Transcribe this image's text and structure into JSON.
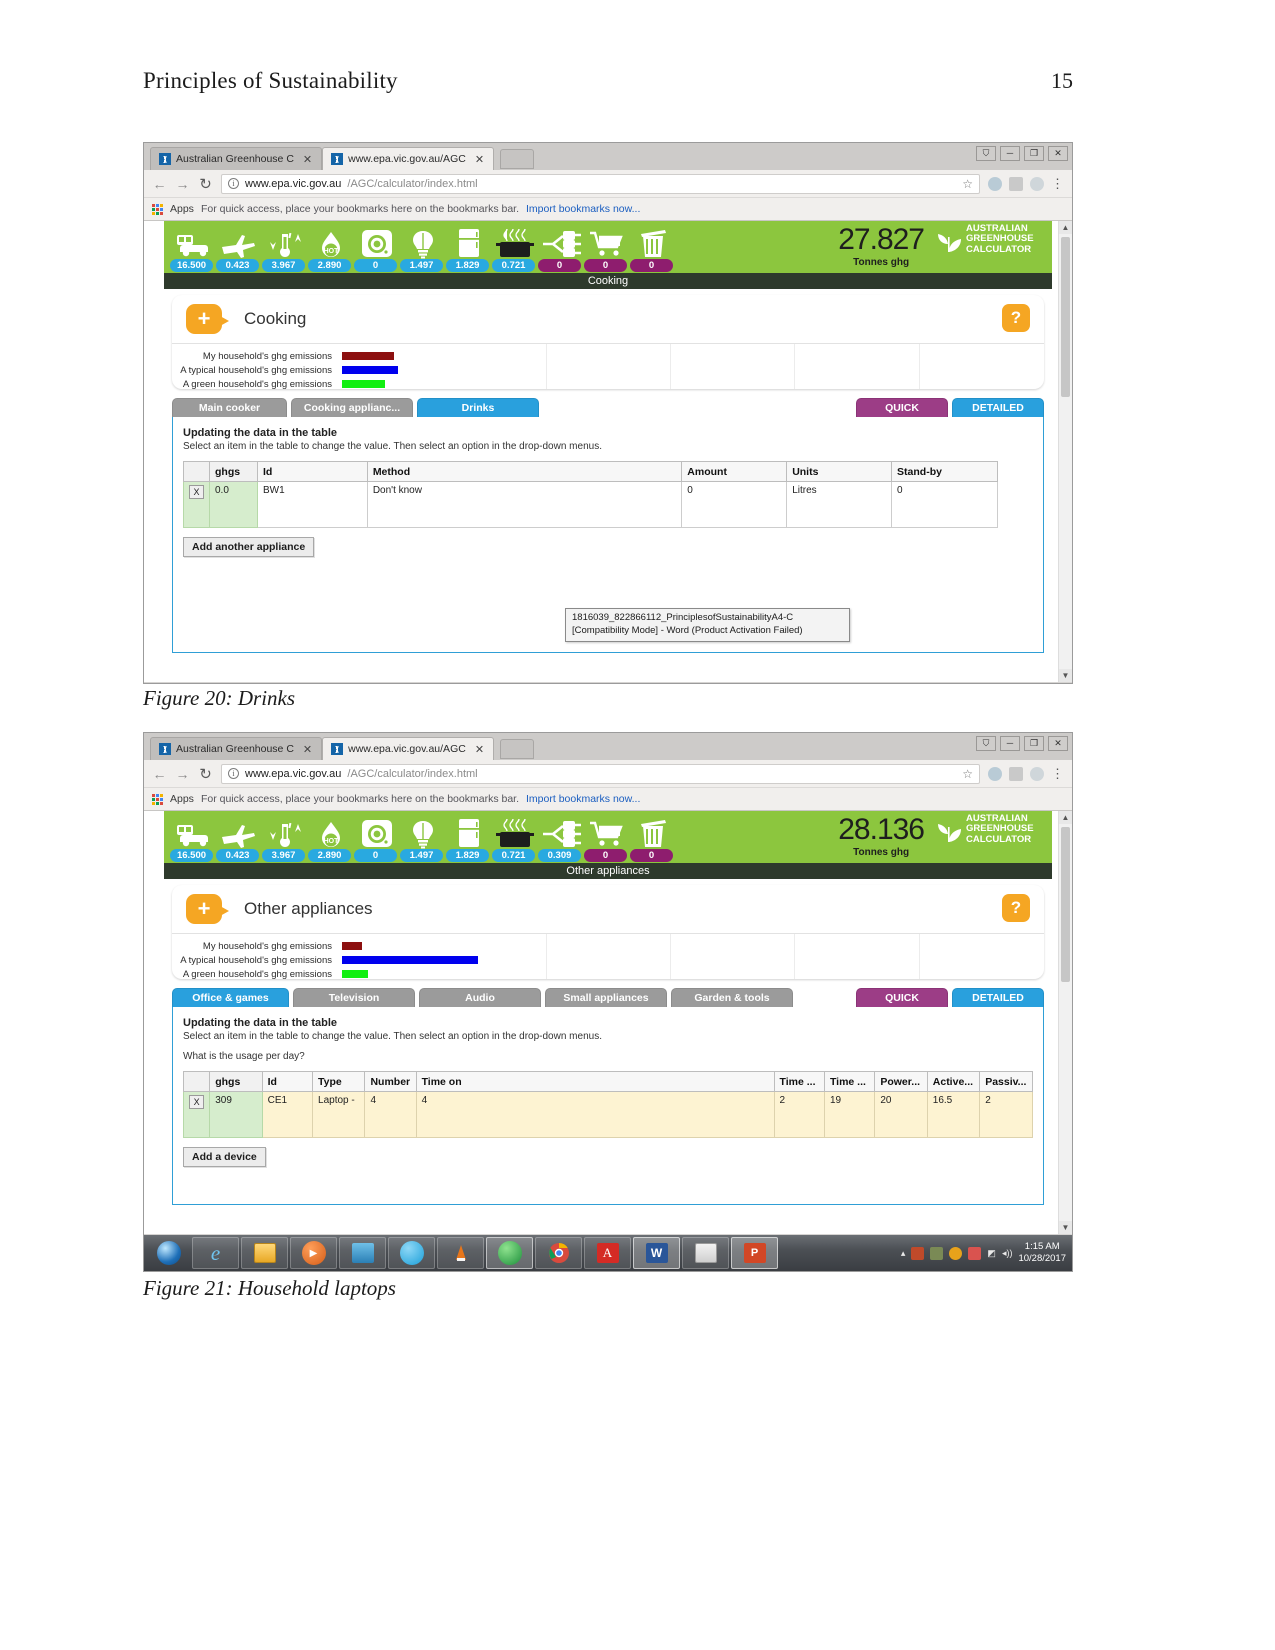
{
  "page": {
    "title": "Principles of Sustainability",
    "number": "15"
  },
  "captions": {
    "figure20": "Figure 20: Drinks",
    "figure21": "Figure 21: Household laptops"
  },
  "browser": {
    "tabs": [
      {
        "label": "Australian Greenhouse C",
        "close": "✕",
        "active": false
      },
      {
        "label": "www.epa.vic.gov.au/AGC",
        "close": "✕",
        "active": true
      }
    ],
    "window_controls": {
      "account": "⛉",
      "minimize": "─",
      "maximize": "❐",
      "close": "✕"
    },
    "nav": {
      "back": "←",
      "forward": "→",
      "reload": "↻",
      "info": "i",
      "star": "☆",
      "menu": "⋮"
    },
    "url": {
      "host": "www.epa.vic.gov.au",
      "rest": "/AGC/calculator/index.html"
    },
    "bookmarks": {
      "apps_label": "Apps",
      "hint": "For quick access, place your bookmarks here on the bookmarks bar.",
      "link": "Import bookmarks now..."
    }
  },
  "calculator": {
    "icons": [
      "car-icon",
      "plane-icon",
      "thermometer-icon",
      "hot-water-icon",
      "washing-machine-icon",
      "lightbulb-icon",
      "fridge-icon",
      "cooking-pot-icon",
      "appliances-plug-icon",
      "shopping-trolley-icon",
      "waste-bin-icon"
    ],
    "brand": {
      "line1": "AUSTRALIAN",
      "line2": "GREENHOUSE",
      "line3": "CALCULATOR"
    },
    "unit_label": "Tonnes ghg",
    "legend": [
      {
        "label": "My household's ghg emissions",
        "color": "#8c0f0f"
      },
      {
        "label": "A typical household's ghg emissions",
        "color": "#0000ee"
      },
      {
        "label": "A green household's ghg emissions",
        "color": "#11ef11"
      }
    ],
    "updating_heading": "Updating the data in the table",
    "updating_text": "Select an item in the table to change the value. Then select an option in the drop-down menus.",
    "quick_label": "QUICK",
    "detailed_label": "DETAILED"
  },
  "figure20": {
    "values": [
      "16.500",
      "0.423",
      "3.967",
      "2.890",
      "0",
      "1.497",
      "1.829",
      "0.721",
      "0",
      "0",
      "0"
    ],
    "value_colors": [
      "blue",
      "blue",
      "blue",
      "blue",
      "blue",
      "blue",
      "blue",
      "blue",
      "purple",
      "purple",
      "purple"
    ],
    "total": "27.827",
    "section_strip": "Cooking",
    "panel_title": "Cooking",
    "plus_label": "+",
    "help_label": "?",
    "legend_bar_widths": [
      "52",
      "56",
      "43"
    ],
    "tabs": [
      {
        "label": "Main cooker",
        "active": false
      },
      {
        "label": "Cooking applianc...",
        "active": false
      },
      {
        "label": "Drinks",
        "active": true
      }
    ],
    "table": {
      "headers": [
        "",
        "ghgs",
        "Id",
        "Method",
        "Amount",
        "Units",
        "Stand-by"
      ],
      "rows": [
        {
          "x": "X",
          "ghgs": "0.0",
          "id": "BW1",
          "method": "Don't know",
          "amount": "0",
          "units": "Litres",
          "standby": "0"
        }
      ]
    },
    "add_button": "Add another appliance",
    "word_tooltip": {
      "line1": "1816039_822866112_PrinciplesofSustainabilityA4-C",
      "line2": "[Compatibility Mode] - Word (Product Activation Failed)"
    }
  },
  "figure21": {
    "values": [
      "16.500",
      "0.423",
      "3.967",
      "2.890",
      "0",
      "1.497",
      "1.829",
      "0.721",
      "0.309",
      "0",
      "0"
    ],
    "value_colors": [
      "blue",
      "blue",
      "blue",
      "blue",
      "blue",
      "blue",
      "blue",
      "blue",
      "blue",
      "purple",
      "purple"
    ],
    "total": "28.136",
    "section_strip": "Other appliances",
    "panel_title": "Other appliances",
    "plus_label": "+",
    "help_label": "?",
    "legend_bar_widths": [
      "20",
      "136",
      "26"
    ],
    "tabs": [
      {
        "label": "Office & games",
        "active": true
      },
      {
        "label": "Television",
        "active": false
      },
      {
        "label": "Audio",
        "active": false
      },
      {
        "label": "Small appliances",
        "active": false
      },
      {
        "label": "Garden & tools",
        "active": false
      }
    ],
    "usage_question": "What is the usage per day?",
    "table": {
      "headers": [
        "",
        "ghgs",
        "Id",
        "Type",
        "Number",
        "Time on",
        "Time ...",
        "Time ...",
        "Power...",
        "Active...",
        "Passiv..."
      ],
      "rows": [
        {
          "x": "X",
          "ghgs": "309",
          "id": "CE1",
          "type": "Laptop -",
          "number": "4",
          "time_on": "4",
          "time1": "2",
          "time2": "19",
          "power": "20",
          "active": "16.5",
          "passive": "2"
        }
      ]
    },
    "add_button": "Add a device"
  },
  "taskbar": {
    "items": [
      "start-orb",
      "internet-explorer-icon",
      "file-explorer-icon",
      "media-player-icon",
      "store-icon",
      "skype-icon",
      "vlc-icon",
      "globe-browser-icon",
      "chrome-icon",
      "acrobat-reader-icon",
      "word-icon",
      "paint-icon",
      "powerpoint-icon"
    ],
    "tray": {
      "expand": "▴",
      "network": "◩",
      "volume": "◂))"
    },
    "clock": {
      "time": "1:15 AM",
      "date": "10/28/2017"
    }
  }
}
